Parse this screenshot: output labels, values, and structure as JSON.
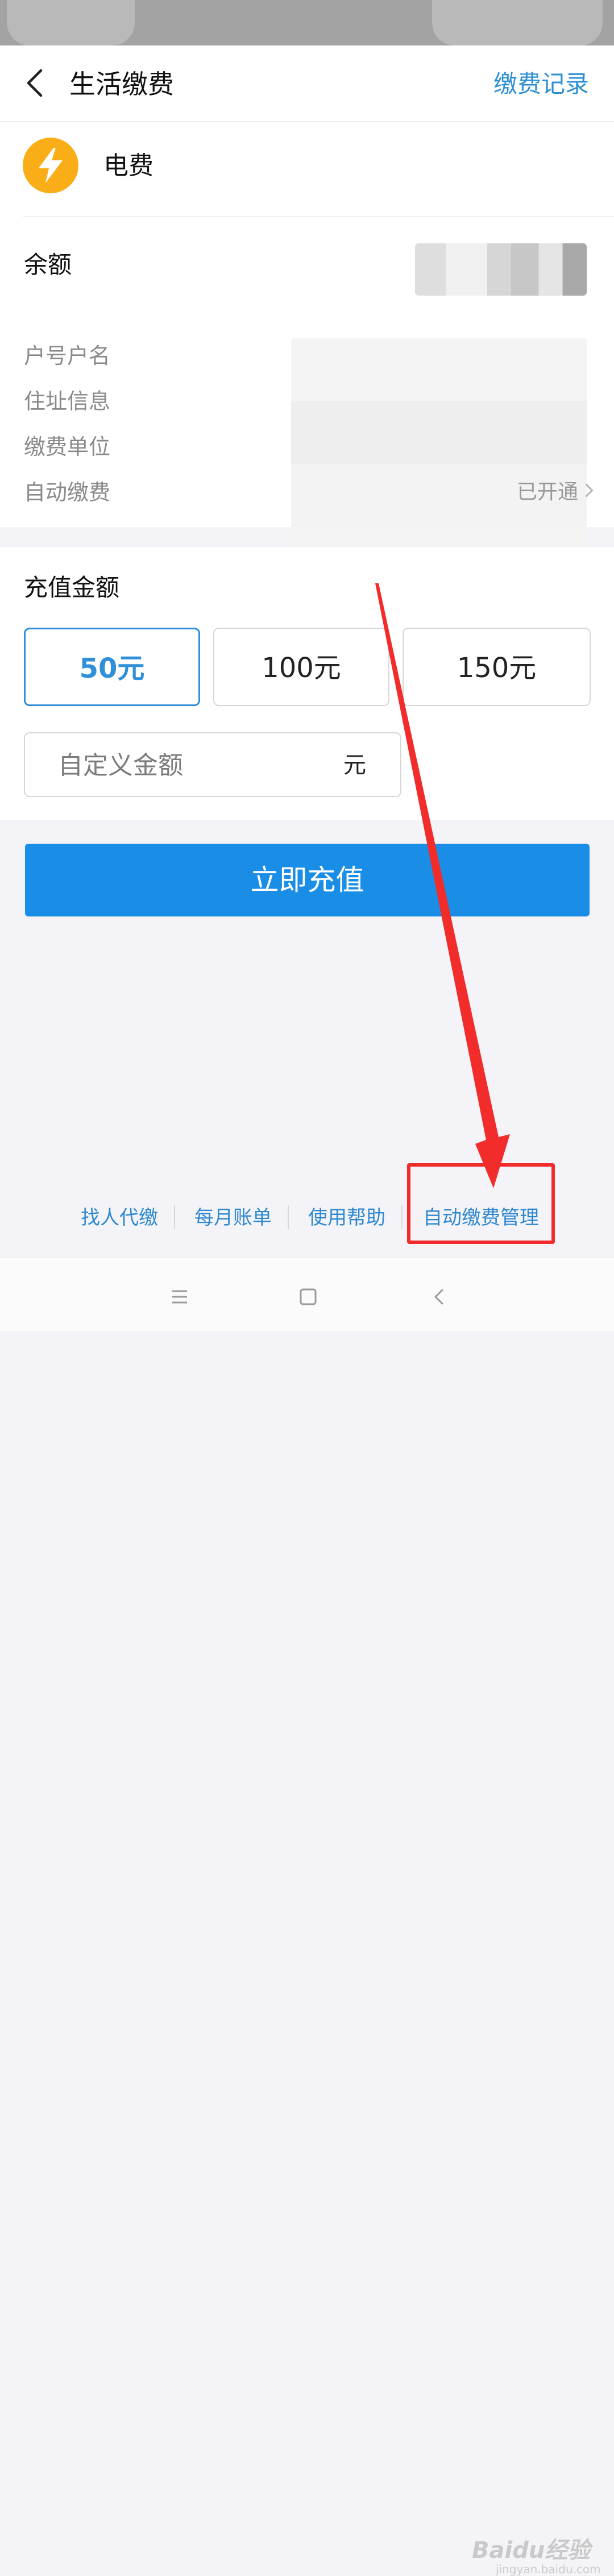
{
  "header": {
    "title": "生活缴费",
    "history_link": "缴费记录"
  },
  "bill": {
    "name": "电费",
    "icon": "lightning-icon",
    "icon_color": "#f9ae18"
  },
  "account": {
    "balance_label": "余额",
    "rows": [
      {
        "label": "户号户名"
      },
      {
        "label": "住址信息"
      },
      {
        "label": "缴费单位"
      },
      {
        "label": "自动缴费",
        "value": "已开通"
      }
    ]
  },
  "recharge": {
    "title": "充值金额",
    "options": [
      "50元",
      "100元",
      "150元"
    ],
    "selected": "50元",
    "custom_placeholder": "自定义金额",
    "custom_unit": "元",
    "pay_button": "立即充值"
  },
  "footer_links": [
    "找人代缴",
    "每月账单",
    "使用帮助",
    "自动缴费管理"
  ],
  "watermark": {
    "text": "Baidu经验",
    "sub": "jingyan.baidu.com"
  },
  "colors": {
    "accent": "#2f8fd8",
    "button": "#1a8ee6",
    "annotation": "#f22b2b"
  }
}
